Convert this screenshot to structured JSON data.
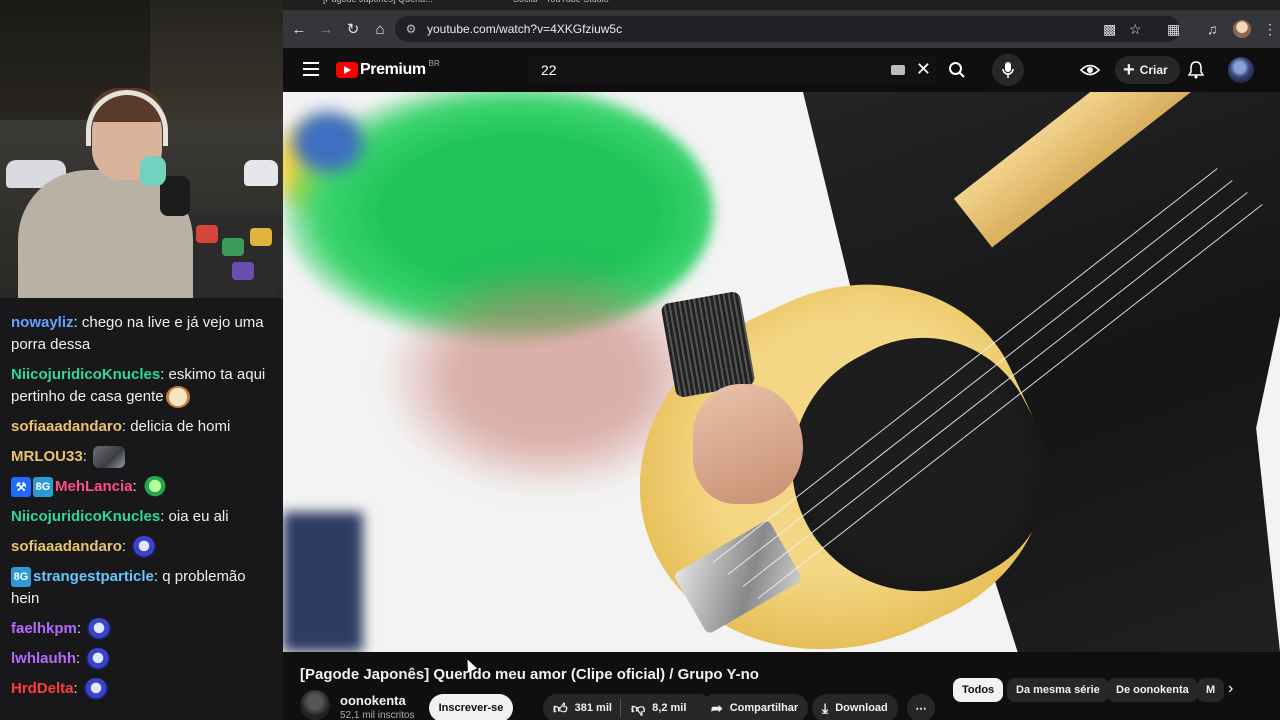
{
  "stream_chat": {
    "messages": [
      {
        "user": "nowayliz",
        "color": "#66a3ff",
        "text": "chego na live e já vejo uma porra dessa",
        "emote": null,
        "badges": []
      },
      {
        "user": "NiicojuridicoKnucles",
        "color": "#2ed6a0",
        "text": "eskimo ta aqui pertinho de casa gente",
        "emote": "face",
        "badges": []
      },
      {
        "user": "sofiaaadandaro",
        "color": "#e9c46a",
        "text": "delicia de homi",
        "emote": null,
        "badges": []
      },
      {
        "user": "MRLOU33",
        "color": "#e9c46a",
        "text": "",
        "emote": "photo",
        "badges": []
      },
      {
        "user": "MehLancia",
        "color": "#ff4d8a",
        "text": "",
        "emote": "alien",
        "badges": [
          "sword",
          "sub"
        ]
      },
      {
        "user": "NiicojuridicoKnucles",
        "color": "#2ed6a0",
        "text": "oia eu ali",
        "emote": null,
        "badges": []
      },
      {
        "user": "sofiaaadandaro",
        "color": "#e9c46a",
        "text": "",
        "emote": "blue",
        "badges": []
      },
      {
        "user": "strangestparticle",
        "color": "#66c6ff",
        "text": "q problemão hein",
        "emote": null,
        "badges": [
          "sub"
        ]
      },
      {
        "user": "faelhkpm",
        "color": "#b36bff",
        "text": "",
        "emote": "blue",
        "badges": []
      },
      {
        "user": "lwhlauhh",
        "color": "#b36bff",
        "text": "",
        "emote": "blue",
        "badges": []
      },
      {
        "user": "HrdDelta",
        "color": "#ff3b3b",
        "text": "",
        "emote": "blue",
        "badges": []
      }
    ],
    "sub_badge_label": "8G"
  },
  "browser": {
    "tabs": [
      "[Pagode Japonês] Querid...",
      "Social - YouTube Studio"
    ],
    "url": "youtube.com/watch?v=4XKGfziuw5c"
  },
  "youtube": {
    "logo_word": "Premium",
    "region": "BR",
    "search_query": "22",
    "create_label": "Criar",
    "video_title": "[Pagode Japonês] Querido meu amor (Clipe oficial) / Grupo Y-no",
    "channel_name": "oonokenta",
    "subscribers": "52,1 mil inscritos",
    "subscribe_label": "Inscrever-se",
    "likes": "381 mil",
    "dislikes": "8,2 mil",
    "share_label": "Compartilhar",
    "download_label": "Download",
    "chips": [
      "Todos",
      "Da mesma série",
      "De oonokenta",
      "M"
    ]
  }
}
